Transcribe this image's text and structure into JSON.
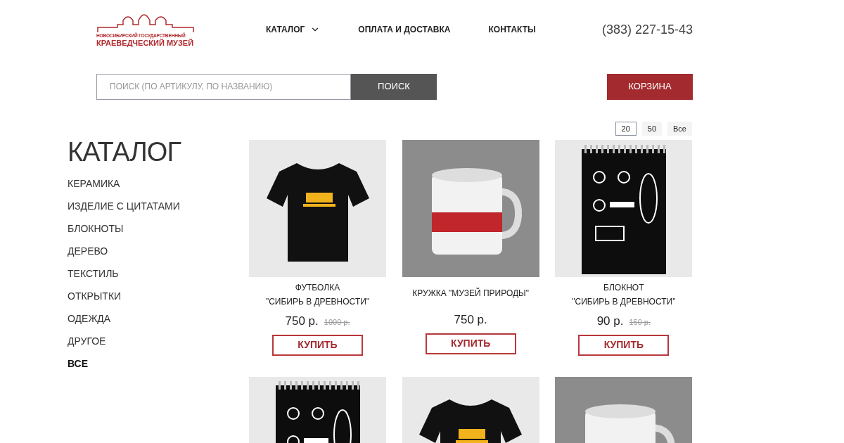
{
  "logo": {
    "line_1": "НОВОСИБИРСКИЙ ГОСУДАРСТВЕННЫЙ",
    "line_2": "КРАЕВЕДЧЕСКИЙ МУЗЕЙ"
  },
  "nav": [
    {
      "label": "КАТАЛОГ",
      "dropdown": true
    },
    {
      "label": "ОПЛАТА И ДОСТАВКА",
      "dropdown": false
    },
    {
      "label": "КОНТАКТЫ",
      "dropdown": false
    }
  ],
  "phone": "(383) 227-15-43",
  "search": {
    "placeholder": "ПОИСК (ПО АРТИКУЛУ, ПО НАЗВАНИЮ)",
    "button": "ПОИСК"
  },
  "cart_button": "КОРЗИНА",
  "page_sizes": [
    {
      "label": "20",
      "selected": true
    },
    {
      "label": "50",
      "selected": false
    },
    {
      "label": "Все",
      "selected": false
    }
  ],
  "sidebar": {
    "title": "КАТАЛОГ",
    "items": [
      {
        "label": "КЕРАМИКА",
        "selected": false
      },
      {
        "label": "ИЗДЕЛИЕ С ЦИТАТАМИ",
        "selected": false
      },
      {
        "label": "БЛОКНОТЫ",
        "selected": false
      },
      {
        "label": "ДЕРЕВО",
        "selected": false
      },
      {
        "label": "ТЕКСТИЛЬ",
        "selected": false
      },
      {
        "label": "ОТКРЫТКИ",
        "selected": false
      },
      {
        "label": "ОДЕЖДА",
        "selected": false
      },
      {
        "label": "ДРУГОЕ",
        "selected": false
      },
      {
        "label": "ВСЕ",
        "selected": true
      }
    ]
  },
  "products": [
    {
      "kind": "tshirt",
      "name_lines": [
        "ФУТБОЛКА",
        "\"СИБИРЬ В ДРЕВНОСТИ\""
      ],
      "price": "750 р.",
      "old_price": "1000 р.",
      "button": "КУПИТЬ"
    },
    {
      "kind": "mug",
      "name_lines": [
        "КРУЖКА \"МУЗЕЙ ПРИРОДЫ\""
      ],
      "price": "750 р.",
      "button": "КУПИТЬ"
    },
    {
      "kind": "notebook",
      "name_lines": [
        "БЛОКНОТ",
        "\"СИБИРЬ В ДРЕВНОСТИ\""
      ],
      "price": "90 р.",
      "old_price": "150 р.",
      "button": "КУПИТЬ"
    },
    {
      "kind": "notebook"
    },
    {
      "kind": "tshirt"
    },
    {
      "kind": "mug"
    }
  ]
}
